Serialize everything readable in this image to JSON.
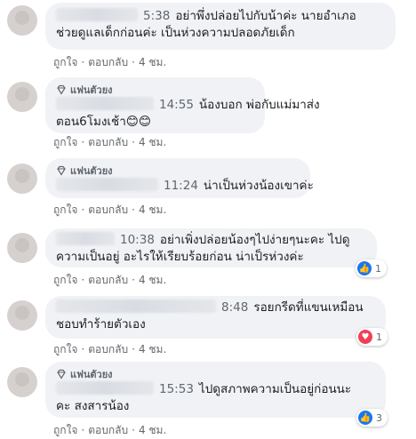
{
  "comments": [
    {
      "time": "5:38",
      "lines": [
        "อย่าพึ่งปล่อยไปกับน้าค่ะ นายอำเภอ",
        "ช่วยดูแลเด็กก่อนค่ะ เป็นห่วงความปลอดภัยเด็ก"
      ],
      "like": "ถูกใจ",
      "reply": "ตอบกลับ",
      "age": "4 ชม."
    },
    {
      "badge": "แฟนตัวยง",
      "time": "14:55",
      "lines": [
        "น้องบอก พ่อกับแม่มาส่ง",
        "ตอน6โมงเช้า😊😊"
      ],
      "like": "ถูกใจ",
      "reply": "ตอบกลับ",
      "age": "4 ชม."
    },
    {
      "badge": "แฟนตัวยง",
      "time": "11:24",
      "lines": [
        "น่าเป็นห่วงน้องเขาค่ะ"
      ],
      "like": "ถูกใจ",
      "reply": "ตอบกลับ",
      "age": "4 ชม."
    },
    {
      "time": "10:38",
      "lines": [
        "อย่าเพิ่งปล่อยน้องๆไปง่ายๆนะคะ ไปดู",
        "ความเป็นอยู่ อะไรให้เรียบร้อยก่อน น่าเป็รห่วงค่ะ"
      ],
      "like": "ถูกใจ",
      "reply": "ตอบกลับ",
      "age": "4 ชม.",
      "reaction": {
        "type": "like-icon",
        "count": "1"
      }
    },
    {
      "time": "8:48",
      "lines": [
        "รอยกรีดที่แขนเหมือน",
        "ชอบทำร้ายตัวเอง"
      ],
      "like": "ถูกใจ",
      "reply": "ตอบกลับ",
      "age": "4 ชม.",
      "reaction": {
        "type": "love-icon",
        "count": "1"
      }
    },
    {
      "badge": "แฟนตัวยง",
      "time": "15:53",
      "lines": [
        "ไปดูสภาพความเป็นอยู่ก่อนนะ",
        "คะ สงสารน้อง"
      ],
      "like": "ถูกใจ",
      "reply": "ตอบกลับ",
      "age": "4 ชม.",
      "reaction": {
        "type": "like-icon",
        "count": "3"
      }
    }
  ],
  "colors": {
    "bubble": "#f0f2f5",
    "like": "#1877f2",
    "love": "#f33e58",
    "meta": "#65676b"
  }
}
